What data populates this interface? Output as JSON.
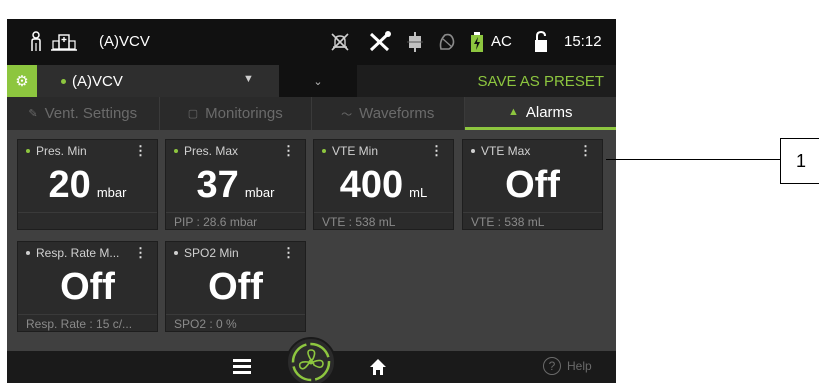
{
  "status_bar": {
    "mode": "(A)VCV",
    "power_label": "AC",
    "time": "15:12",
    "icons": [
      "patient-icon",
      "hospital-icon",
      "alarm-off-icon",
      "tools-icon",
      "filter-icon",
      "mask-icon",
      "battery-icon",
      "unlock-icon"
    ]
  },
  "mode_row": {
    "mode": "(A)VCV",
    "save_label": "SAVE AS PRESET"
  },
  "tabs": [
    {
      "label": "Vent. Settings",
      "icon": "wrench-icon",
      "active": false
    },
    {
      "label": "Monitorings",
      "icon": "monitor-icon",
      "active": false
    },
    {
      "label": "Waveforms",
      "icon": "waveform-icon",
      "active": false
    },
    {
      "label": "Alarms",
      "icon": "bell-icon",
      "active": true
    }
  ],
  "alarms": [
    {
      "name": "Pres. Min",
      "value": "20",
      "unit": "mbar",
      "footer": "",
      "active": true
    },
    {
      "name": "Pres. Max",
      "value": "37",
      "unit": "mbar",
      "footer": "PIP : 28.6 mbar",
      "active": true
    },
    {
      "name": "VTE Min",
      "value": "400",
      "unit": "mL",
      "footer": "VTE : 538 mL",
      "active": true
    },
    {
      "name": "VTE Max",
      "value": "Off",
      "unit": "",
      "footer": "VTE : 538 mL",
      "active": false
    },
    {
      "name": "Resp. Rate M...",
      "value": "Off",
      "unit": "",
      "footer": "Resp. Rate : 15 c/...",
      "active": false
    },
    {
      "name": "SPO2 Min",
      "value": "Off",
      "unit": "",
      "footer": "SPO2 : 0 %",
      "active": false
    }
  ],
  "bottom_bar": {
    "help_label": "Help"
  },
  "callout": {
    "number": "1"
  },
  "colors": {
    "accent": "#8dc63f",
    "background": "#3d3d3d"
  }
}
